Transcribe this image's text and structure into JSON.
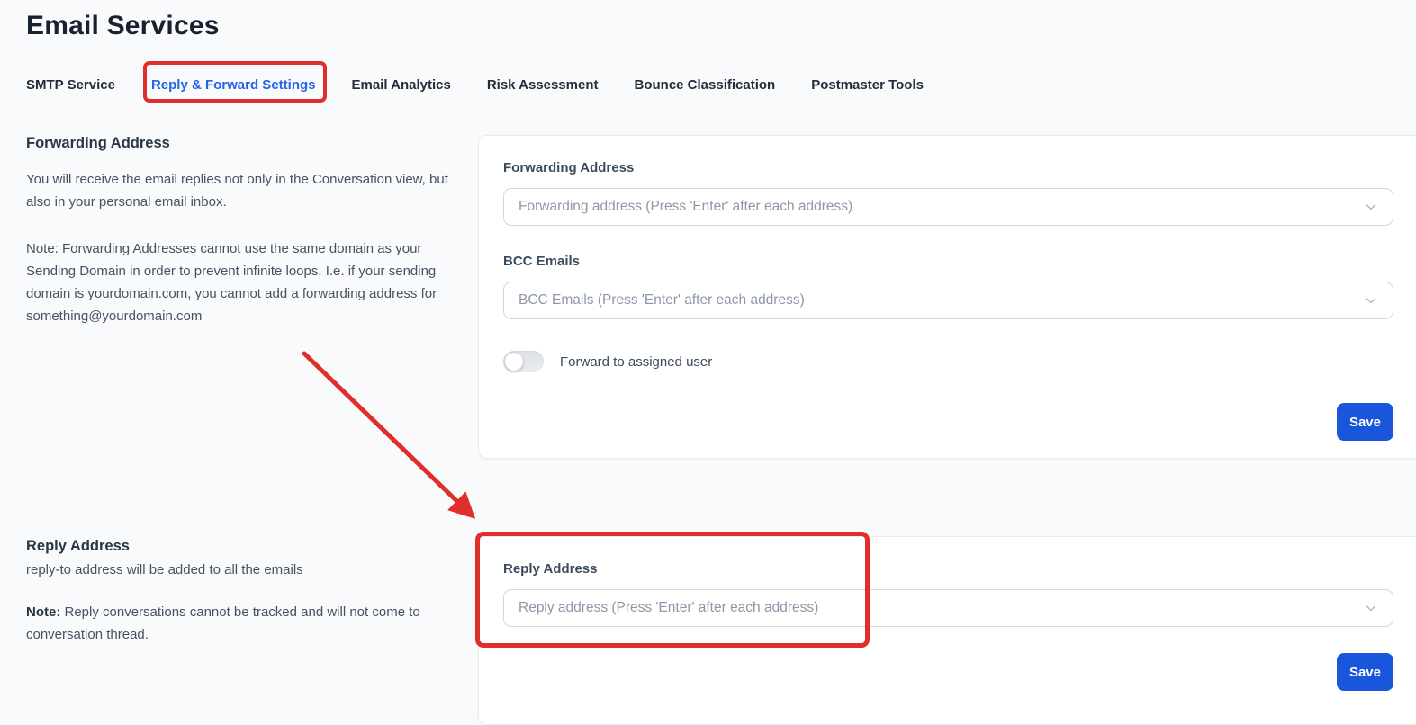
{
  "page": {
    "title": "Email Services"
  },
  "tabs": {
    "items": [
      {
        "label": "SMTP Service",
        "active": false
      },
      {
        "label": "Reply & Forward Settings",
        "active": true,
        "annotated": true
      },
      {
        "label": "Email Analytics",
        "active": false
      },
      {
        "label": "Risk Assessment",
        "active": false
      },
      {
        "label": "Bounce Classification",
        "active": false
      },
      {
        "label": "Postmaster Tools",
        "active": false
      }
    ],
    "active_color": "#2563eb"
  },
  "forwarding_section": {
    "sidebar": {
      "heading": "Forwarding Address",
      "description": "You will receive the email replies not only in the Conversation view, but also in your personal email inbox.",
      "note": "Note: Forwarding Addresses cannot use the same domain as your Sending Domain in order to prevent infinite loops. I.e. if your sending domain is yourdomain.com, you cannot add a forwarding address for something@yourdomain.com"
    },
    "form": {
      "forwarding_label": "Forwarding Address",
      "forwarding_placeholder": "Forwarding address (Press 'Enter' after each address)",
      "forwarding_value": "",
      "bcc_label": "BCC Emails",
      "bcc_placeholder": "BCC Emails (Press 'Enter' after each address)",
      "bcc_value": "",
      "toggle_label": "Forward to assigned user",
      "toggle_state": "off",
      "save_label": "Save"
    }
  },
  "reply_section": {
    "sidebar": {
      "heading": "Reply Address",
      "description": "reply-to address will be added to all the emails",
      "note_bold": "Note:",
      "note_rest": " Reply conversations cannot be tracked and will not come to conversation thread."
    },
    "form": {
      "reply_label": "Reply Address",
      "reply_placeholder": "Reply address (Press 'Enter' after each address)",
      "reply_value": "",
      "save_label": "Save"
    }
  },
  "annotations": {
    "color": "#e02e2a",
    "highlighted_tab": "Reply & Forward Settings",
    "highlighted_field": "Reply Address",
    "arrow": "points from forwarding note text to Reply Address field"
  },
  "colors": {
    "background": "#f9fafb",
    "card": "#ffffff",
    "save_button": "#1a56db",
    "active_tab": "#2563eb",
    "annotation_red": "#e02e2a"
  }
}
